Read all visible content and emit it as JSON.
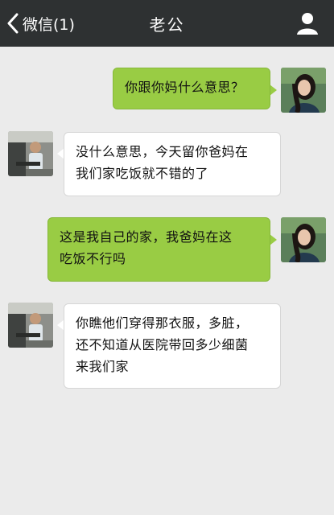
{
  "header": {
    "back_label": "微信(1)",
    "title": "老公"
  },
  "messages": [
    {
      "direction": "outgoing",
      "sender": "self",
      "text": "你跟你妈什么意思？"
    },
    {
      "direction": "incoming",
      "sender": "contact",
      "lines": [
        "没什么意思，今天留你爸妈在",
        "我们家吃饭就不错的了"
      ]
    },
    {
      "direction": "outgoing",
      "sender": "self",
      "lines": [
        "这是我自己的家，我爸妈在这",
        "吃饭不行吗"
      ]
    },
    {
      "direction": "incoming",
      "sender": "contact",
      "lines": [
        "你瞧他们穿得那衣服，多脏，",
        "还不知道从医院带回多少细菌",
        "来我们家"
      ]
    }
  ],
  "colors": {
    "navbar": "#2e3132",
    "background": "#ebebeb",
    "outgoing_bubble": "#99cc44",
    "incoming_bubble": "#ffffff"
  },
  "icons": {
    "back": "chevron-left-icon",
    "profile": "person-icon"
  }
}
